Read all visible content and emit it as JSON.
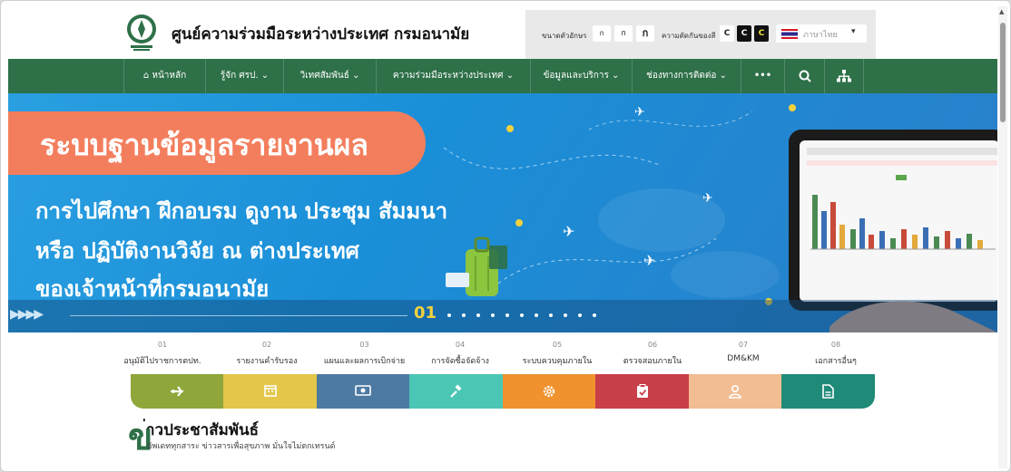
{
  "header": {
    "site_title": "ศูนย์ความร่วมมือระหว่างประเทศ กรมอนามัย",
    "font_size_label": "ขนาดตัวอักษร",
    "font_size_options": [
      "ก",
      "ก",
      "ก"
    ],
    "contrast_label": "ความตัดกันของสี",
    "contrast_options": [
      "C",
      "C",
      "C"
    ],
    "language": "ภาษาไทย"
  },
  "nav": {
    "items": [
      {
        "label": "หน้าหลัก"
      },
      {
        "label": "รู้จัก ศรป."
      },
      {
        "label": "วิเทศสัมพันธ์"
      },
      {
        "label": "ความร่วมมือระหว่างประเทศ"
      },
      {
        "label": "ข้อมูลและบริการ"
      },
      {
        "label": "ช่องทางการติดต่อ"
      }
    ],
    "more_label": "•••"
  },
  "banner": {
    "headline": "ระบบฐานข้อมูลรายงานผล",
    "lines": [
      "การไปศึกษา ฝึกอบรม ดูงาน ประชุม สัมมนา",
      "หรือ ปฏิบัติงานวิจัย ณ ต่างประเทศ",
      "ของเจ้าหน้าที่กรมอนามัย"
    ],
    "slide_number": "01"
  },
  "sections": [
    {
      "num": "01",
      "label": "อนุมัติไปราชการตปท."
    },
    {
      "num": "02",
      "label": "รายงานคำรับรอง"
    },
    {
      "num": "03",
      "label": "แผนและผลการเบิกจ่าย"
    },
    {
      "num": "04",
      "label": "การจัดซื้อจัดจ้าง"
    },
    {
      "num": "05",
      "label": "ระบบควบคุมภายใน"
    },
    {
      "num": "06",
      "label": "ตรวจสอบภายใน"
    },
    {
      "num": "07",
      "label": "DM&KM"
    },
    {
      "num": "08",
      "label": "เอกสารอื่นๆ"
    }
  ],
  "tile_colors": [
    "#8ea63a",
    "#e3c64a",
    "#4d7aa2",
    "#4bc6b4",
    "#f0922d",
    "#c83f49",
    "#f2bd93",
    "#1f8a78"
  ],
  "tile_icons": [
    "airplane-icon",
    "calendar-icon",
    "money-icon",
    "gavel-icon",
    "gear-icon",
    "clipboard-check-icon",
    "user-icon",
    "document-icon"
  ],
  "news": {
    "mark": "ข",
    "title": "่าวประชาสัมพันธ์",
    "subtitle": "อัพเดททุกสาระ ข่าวสารเพื่อสุขภาพ มั่นใจไม่ตกเทรนด์"
  },
  "colors": {
    "nav_green": "#2e7048",
    "banner_blue": "#1a8fd8",
    "pill_orange": "#f37e5d"
  }
}
